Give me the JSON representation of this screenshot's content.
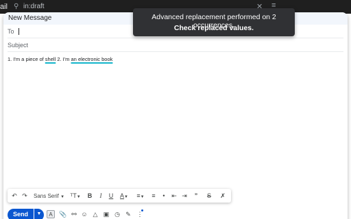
{
  "background": {
    "app_label": "ail",
    "search_text": "in:draft"
  },
  "compose": {
    "title": "New Message",
    "to_label": "To",
    "subject_label": "Subject",
    "body": {
      "prefix": "1. I'm a piece of ",
      "match1": "shell",
      "middle": " 2. I'm ",
      "match2": "an electronic book",
      "highlight_color": "#12b5cb"
    }
  },
  "toast": {
    "line1": "Advanced replacement performed on 2 occurrences.",
    "line2": "Check replaced values."
  },
  "toolbar": {
    "font": "Sans Serif"
  },
  "actions": {
    "send_label": "Send",
    "accent": "#0b57d0"
  }
}
